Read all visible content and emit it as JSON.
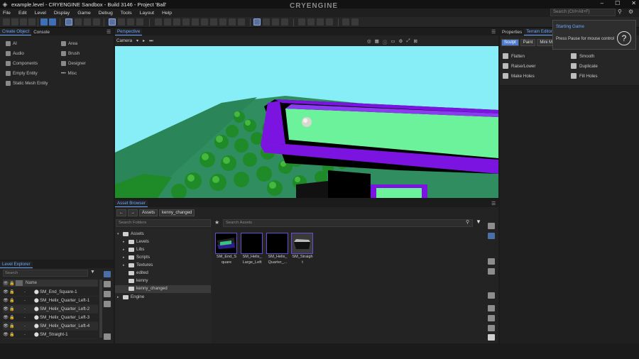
{
  "window": {
    "title": "example.level - CRYENGINE Sandbox - Build 3146 - Project 'Ball'",
    "brand": "CRYENGINE",
    "controls": [
      "–",
      "☐",
      "✕"
    ]
  },
  "menu": [
    "File",
    "Edit",
    "Level",
    "Display",
    "Game",
    "Debug",
    "Tools",
    "Layout",
    "Help"
  ],
  "search": {
    "placeholder": "Search (Ctrl+Alt+F)"
  },
  "create_object": {
    "tabs": [
      "Create Object",
      "Console"
    ],
    "items": [
      "AI",
      "Audio",
      "Components",
      "Empty Entity",
      "Static Mesh Entity",
      "Area",
      "Brush",
      "Designer",
      "Misc"
    ]
  },
  "viewport": {
    "title": "Perspective",
    "camera_label": "Camera"
  },
  "asset_browser": {
    "title": "Asset Browser",
    "breadcrumb": [
      "Assets",
      "kenny_changed"
    ],
    "folder_search_placeholder": "Search Folders",
    "asset_search_placeholder": "Search Assets",
    "tree": [
      "Assets",
      "Levels",
      "Libs",
      "Scripts",
      "Textures",
      "edited",
      "kenny",
      "kenny_changed",
      "Engine"
    ],
    "assets": [
      {
        "line1": "SM_End_S",
        "line2": "quare"
      },
      {
        "line1": "SM_Helix_",
        "line2": "Large_Left"
      },
      {
        "line1": "SM_Helix_",
        "line2": "Quarter_..."
      },
      {
        "line1": "SM_Straigh",
        "line2": "t"
      }
    ]
  },
  "level_explorer": {
    "title": "Level Explorer",
    "search_placeholder": "Search",
    "name_col": "Name",
    "rows": [
      "SM_End_Square-1",
      "SM_Helix_Quarter_Left-1",
      "SM_Helix_Quarter_Left-2",
      "SM_Helix_Quarter_Left-3",
      "SM_Helix_Quarter_Left-4",
      "SM_Straight-1"
    ]
  },
  "right_panel": {
    "tabs": [
      "Properties",
      "Terrain Editor"
    ],
    "sub_tabs": [
      "Sculpt",
      "Paint",
      "Mini Map"
    ],
    "tools": [
      "Flatten",
      "Smooth",
      "Raise/Lower",
      "Duplicate",
      "Make Holes",
      "Fill Holes"
    ]
  },
  "notification": {
    "title": "Starting Game",
    "message": "Press Pause for mouse control",
    "help": "?"
  }
}
